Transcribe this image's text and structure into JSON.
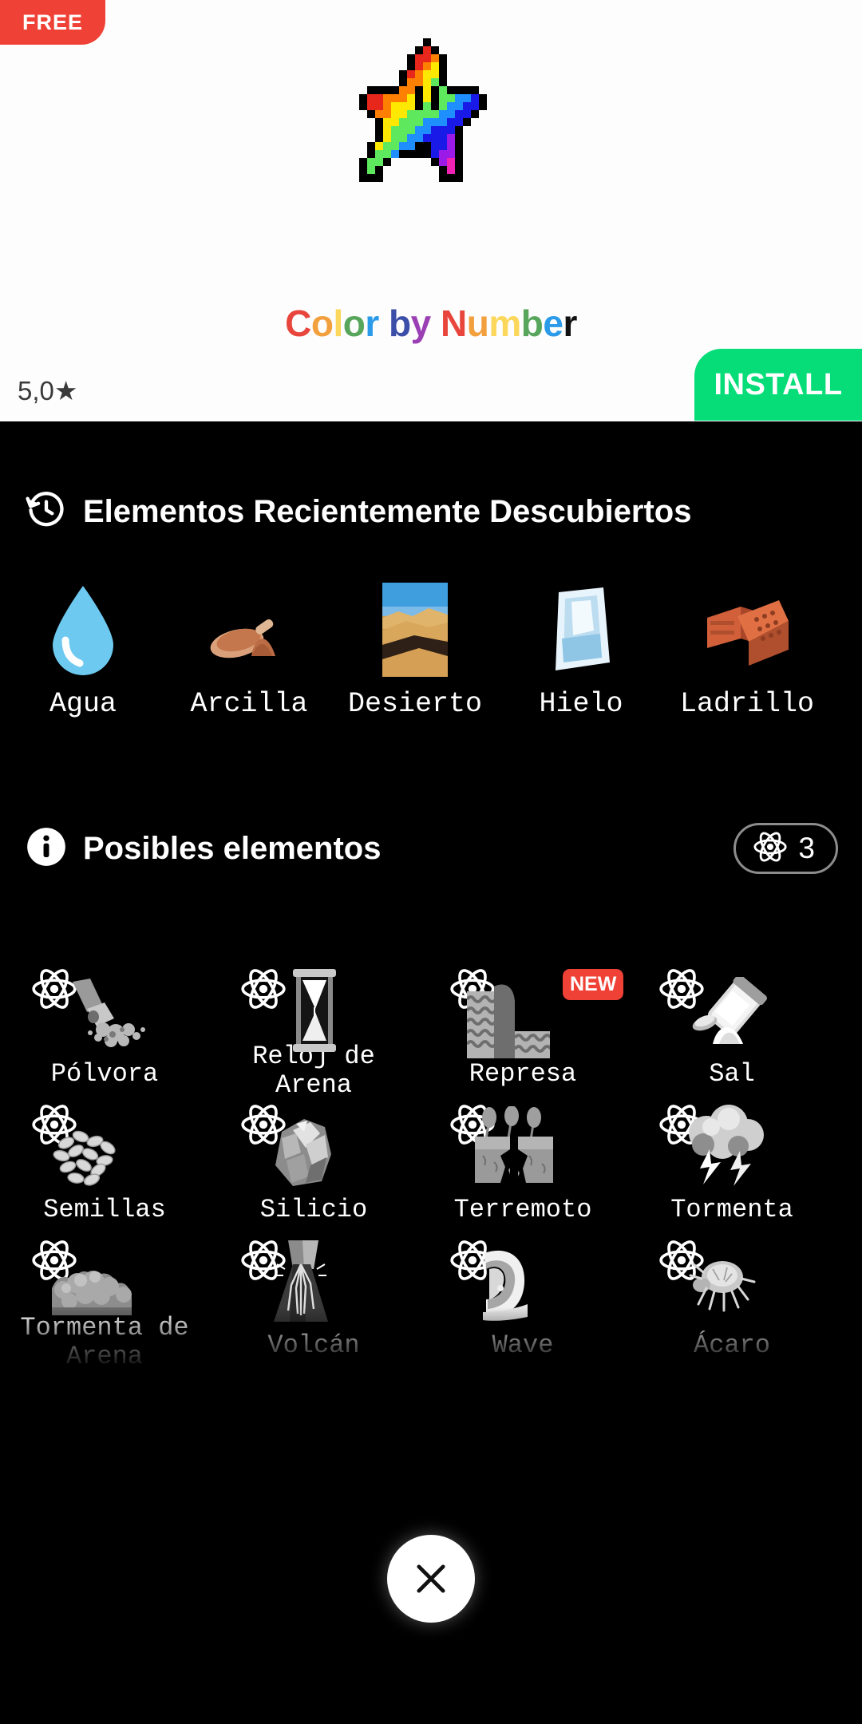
{
  "ad": {
    "free_badge": "FREE",
    "title_letters": [
      {
        "ch": "C",
        "color": "#e8453c"
      },
      {
        "ch": "o",
        "color": "#f2a03d"
      },
      {
        "ch": "l",
        "color": "#fbd75b"
      },
      {
        "ch": "o",
        "color": "#58a55c"
      },
      {
        "ch": "r",
        "color": "#2b9ae8"
      },
      {
        "ch": " ",
        "color": "#000000"
      },
      {
        "ch": "b",
        "color": "#3b4ea8"
      },
      {
        "ch": "y",
        "color": "#9b3fb5"
      },
      {
        "ch": " ",
        "color": "#000000"
      },
      {
        "ch": "N",
        "color": "#e8453c"
      },
      {
        "ch": "u",
        "color": "#f2a03d"
      },
      {
        "ch": "m",
        "color": "#fbd75b"
      },
      {
        "ch": "b",
        "color": "#58a55c"
      },
      {
        "ch": "e",
        "color": "#2b9ae8"
      },
      {
        "ch": "r",
        "color": "#111111"
      }
    ],
    "title_plain": "Color by Number",
    "rating": "5,0",
    "rating_star": "★",
    "install_label": "INSTALL",
    "install_color": "#06dd78",
    "free_color": "#ef4136",
    "icon_name": "pixel-rainbow-star"
  },
  "recent": {
    "icon": "history-icon",
    "title": "Elementos Recientemente Descubiertos",
    "items": [
      {
        "label": "Agua",
        "art": "water-drop"
      },
      {
        "label": "Arcilla",
        "art": "clay-powder"
      },
      {
        "label": "Desierto",
        "art": "desert-photo"
      },
      {
        "label": "Hielo",
        "art": "ice-cube"
      },
      {
        "label": "Ladrillo",
        "art": "bricks"
      }
    ]
  },
  "possible": {
    "icon": "info-icon",
    "title": "Posibles elementos",
    "counter": {
      "icon": "atom-icon",
      "value": "3"
    },
    "rows": [
      [
        {
          "label": "Pólvora",
          "art": "gunpowder",
          "new": false
        },
        {
          "label": "Reloj de Arena",
          "art": "hourglass",
          "new": false
        },
        {
          "label": "Represa",
          "art": "dam",
          "new": true,
          "new_label": "NEW"
        },
        {
          "label": "Sal",
          "art": "salt-shaker",
          "new": false
        }
      ],
      [
        {
          "label": "Semillas",
          "art": "seeds",
          "new": false
        },
        {
          "label": "Silicio",
          "art": "silicon-rock",
          "new": false
        },
        {
          "label": "Terremoto",
          "art": "earthquake",
          "new": false
        },
        {
          "label": "Tormenta",
          "art": "thunderstorm",
          "new": false
        }
      ],
      [
        {
          "label": "Tormenta de Arena",
          "art": "sandstorm",
          "new": false
        },
        {
          "label": "Volcán",
          "art": "volcano",
          "new": false
        },
        {
          "label": "Wave",
          "art": "wave",
          "new": false
        },
        {
          "label": "Ácaro",
          "art": "mite",
          "new": false
        }
      ]
    ]
  },
  "close_button": {
    "icon": "close-icon",
    "label": "✕"
  },
  "theme": {
    "background": "#000000",
    "text": "#ffffff",
    "accent_red": "#ef4136",
    "accent_green": "#06dd78"
  }
}
